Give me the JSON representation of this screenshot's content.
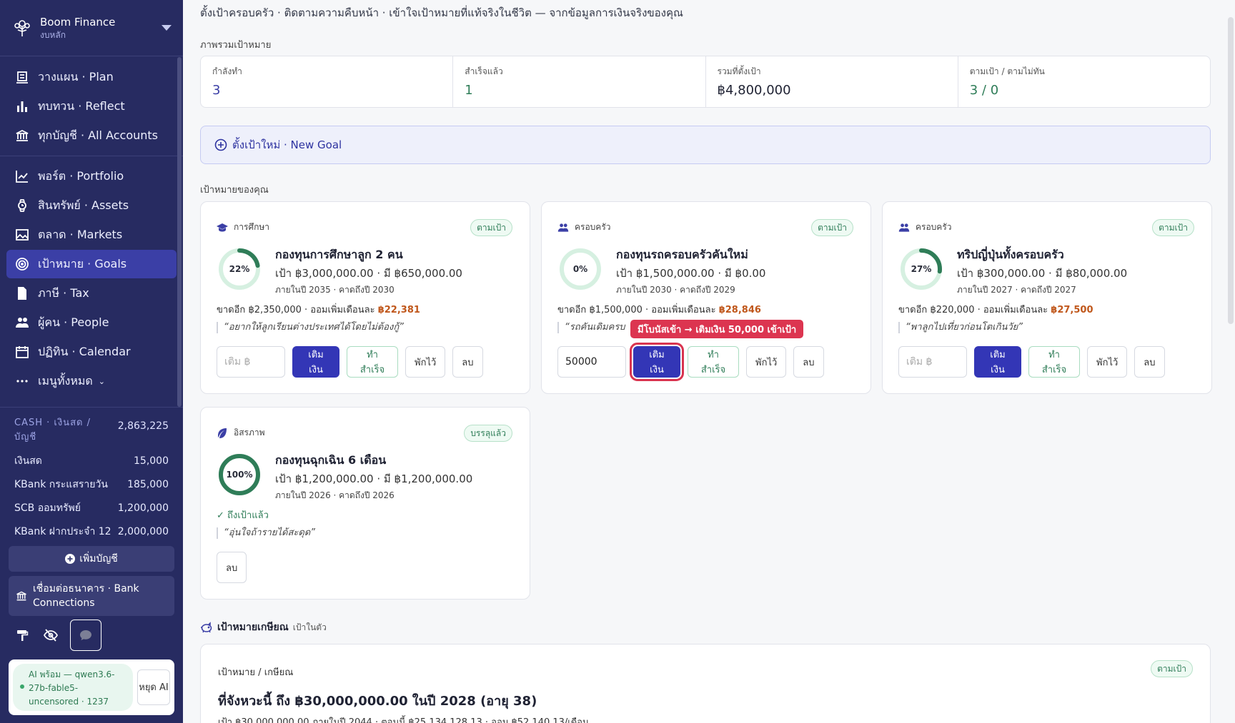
{
  "brand": {
    "name": "Boom Finance",
    "sub": "งบหลัก"
  },
  "nav": [
    {
      "label": "วางแผน · Plan",
      "icon": "plan-icon"
    },
    {
      "label": "ทบทวน · Reflect",
      "icon": "bar-chart-icon"
    },
    {
      "label": "ทุกบัญชี · All Accounts",
      "icon": "bank-icon"
    },
    {
      "label": "พอร์ต · Portfolio",
      "icon": "line-chart-icon"
    },
    {
      "label": "สินทรัพย์ · Assets",
      "icon": "watch-icon"
    },
    {
      "label": "ตลาด · Markets",
      "icon": "image-chart-icon"
    },
    {
      "label": "เป้าหมาย · Goals",
      "icon": "target-icon"
    },
    {
      "label": "ภาษี · Tax",
      "icon": "document-icon"
    },
    {
      "label": "ผู้คน · People",
      "icon": "people-icon"
    },
    {
      "label": "ปฏิทิน · Calendar",
      "icon": "calendar-icon"
    },
    {
      "label": "เมนูทั้งหมด",
      "icon": "more-icon"
    }
  ],
  "cash": {
    "title": "CASH · เงินสด / บัญชี",
    "total": "2,863,225",
    "accounts": [
      {
        "name": "เงินสด",
        "value": "15,000"
      },
      {
        "name": "KBank กระแสรายวัน",
        "value": "185,000"
      },
      {
        "name": "SCB ออมทรัพย์",
        "value": "1,200,000"
      },
      {
        "name": "KBank ฝากประจำ 12 เ...",
        "value": "2,000,000"
      }
    ],
    "add_label": "เพิ่มบัญชี",
    "bank_conn_label": "เชื่อมต่อธนาคาร · Bank Connections"
  },
  "ai": {
    "status": "AI พร้อม — qwen3.6-27b-fable5-uncensored · 1237",
    "stop_label": "หยุด AI"
  },
  "page": {
    "description": "ตั้งเป้าครอบครัว · ติดตามความคืบหน้า · เข้าใจเป้าหมายที่แท้จริงในชีวิต — จากข้อมูลการเงินจริงของคุณ",
    "overview_label": "ภาพรวมเป้าหมาย",
    "your_goals_label": "เป้าหมายของคุณ",
    "new_goal_label": "ตั้งเป้าใหม่ · New Goal"
  },
  "summary": [
    {
      "label": "กำลังทำ",
      "value": "3",
      "color": "#3b3fa6"
    },
    {
      "label": "สำเร็จแล้ว",
      "value": "1",
      "color": "#2f7d58"
    },
    {
      "label": "รวมที่ตั้งเป้า",
      "value": "฿4,800,000",
      "color": "#1f2233"
    },
    {
      "label": "ตามเป้า / ตามไม่ทัน",
      "value": "3 / 0",
      "color": "#2f7d58"
    }
  ],
  "goals": [
    {
      "category": "การศึกษา",
      "icon": "graduation-cap-icon",
      "badge": "ตามเป้า",
      "percent": 22,
      "percent_label": "22%",
      "title": "กองทุนการศึกษาลูก 2 คน",
      "amounts": "เป้า ฿3,000,000.00 · มี ฿650,000.00",
      "years": "ภายในปี 2035 · คาดถึงปี 2030",
      "short_prefix": "ขาดอีก ฿2,350,000 · ออมเพิ่มเดือนละ ",
      "monthly": "฿22,381",
      "quote": "“อยากให้ลูกเรียนต่างประเทศได้โดยไม่ต้องกู้”",
      "input_value": "",
      "input_placeholder": "เติม ฿",
      "actions": {
        "topup": "เติมเงิน",
        "complete": "ทำสำเร็จ",
        "pause": "พักไว้",
        "delete": "ลบ"
      }
    },
    {
      "category": "ครอบครัว",
      "icon": "family-icon",
      "badge": "ตามเป้า",
      "percent": 0,
      "percent_label": "0%",
      "title": "กองทุนรถครอบครัวคันใหม่",
      "amounts": "เป้า ฿1,500,000.00 · มี ฿0.00",
      "years": "ภายในปี 2030 · คาดถึงปี 2029",
      "short_prefix": "ขาดอีก ฿1,500,000 · ออมเพิ่มเดือนละ ",
      "monthly": "฿28,846",
      "quote": "“รถคันเดิมครบ",
      "input_value": "50000",
      "input_placeholder": "เติม ฿",
      "tooltip": "มีโบนัสเข้า → เติมเงิน 50,000 เข้าเป้า",
      "actions": {
        "topup": "เติมเงิน",
        "complete": "ทำสำเร็จ",
        "pause": "พักไว้",
        "delete": "ลบ"
      }
    },
    {
      "category": "ครอบครัว",
      "icon": "family-icon",
      "badge": "ตามเป้า",
      "percent": 27,
      "percent_label": "27%",
      "title": "ทริปญี่ปุ่นทั้งครอบครัว",
      "amounts": "เป้า ฿300,000.00 · มี ฿80,000.00",
      "years": "ภายในปี 2027 · คาดถึงปี 2027",
      "short_prefix": "ขาดอีก ฿220,000 · ออมเพิ่มเดือนละ ",
      "monthly": "฿27,500",
      "quote": "“พาลูกไปเที่ยวก่อนโตเกินวัย”",
      "input_value": "",
      "input_placeholder": "เติม ฿",
      "actions": {
        "topup": "เติมเงิน",
        "complete": "ทำสำเร็จ",
        "pause": "พักไว้",
        "delete": "ลบ"
      }
    },
    {
      "category": "อิสรภาพ",
      "icon": "leaf-icon",
      "badge": "บรรลุแล้ว",
      "percent": 100,
      "percent_label": "100%",
      "title": "กองทุนฉุกเฉิน 6 เดือน",
      "amounts": "เป้า ฿1,200,000.00 · มี ฿1,200,000.00",
      "years": "ภายในปี 2026 · คาดถึงปี 2026",
      "done_label": "✓ ถึงเป้าแล้ว",
      "quote": "“อุ่นใจถ้ารายได้สะดุด”",
      "actions": {
        "delete": "ลบ"
      }
    }
  ],
  "retirement": {
    "heading": "เป้าหมายเกษียณ",
    "heading_sub": "เป้าในตัว",
    "label": "เป้าหมาย / เกษียณ",
    "badge": "ตามเป้า",
    "title": "ที่จังหวะนี้ ถึง ฿30,000,000.00 ในปี 2028 (อายุ 38)",
    "detail": "เป้า ฿30,000,000.00 ภายในปี 2044 · ตอนนี้ ฿25,134,128.13 · ออม ฿52,140.13/เดือน"
  },
  "colors": {
    "sidebar": "#272b61",
    "accent": "#3336b6",
    "success": "#2f7d58",
    "amber": "#c0571b",
    "alert": "#dc3550"
  }
}
